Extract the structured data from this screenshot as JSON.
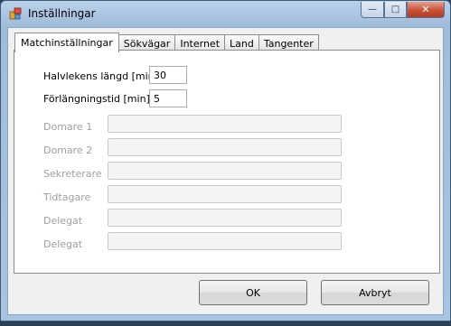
{
  "window": {
    "title": "Inställningar"
  },
  "tabs": [
    {
      "label": "Matchinställningar",
      "active": true
    },
    {
      "label": "Sökvägar"
    },
    {
      "label": "Internet"
    },
    {
      "label": "Land"
    },
    {
      "label": "Tangenter"
    }
  ],
  "fields": {
    "half_length": {
      "label": "Halvlekens längd [min]",
      "value": "30"
    },
    "overtime": {
      "label": "Förlängningstid [min]",
      "value": "5"
    },
    "referee1": {
      "label": "Domare 1",
      "value": ""
    },
    "referee2": {
      "label": "Domare 2",
      "value": ""
    },
    "secretary": {
      "label": "Sekreterare",
      "value": ""
    },
    "timekeeper": {
      "label": "Tidtagare",
      "value": ""
    },
    "delegate1": {
      "label": "Delegat",
      "value": ""
    },
    "delegate2": {
      "label": "Delegat",
      "value": ""
    }
  },
  "buttons": {
    "ok": "OK",
    "cancel": "Avbryt"
  },
  "colors": {
    "disabled_text": "#a0a0a0",
    "close_button": "#c75238"
  }
}
